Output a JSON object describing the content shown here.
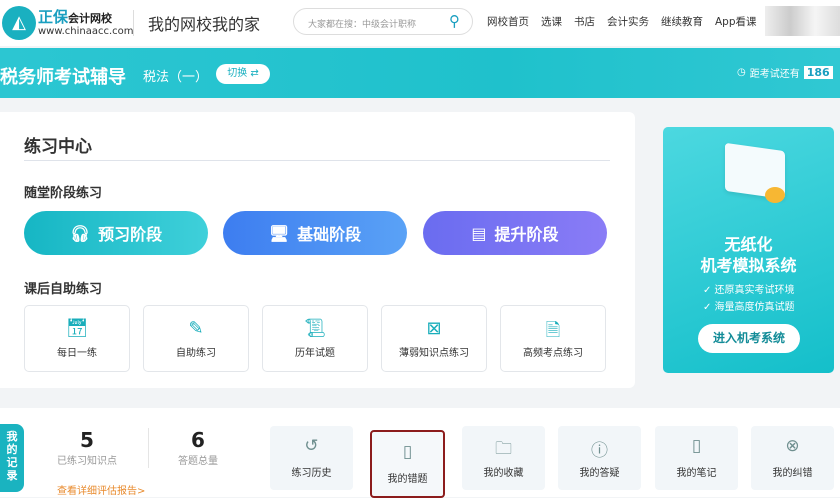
{
  "header": {
    "logo_text": "正保",
    "brand": "正保",
    "brand_sub": "会计网校",
    "url": "www.chinaacc.com",
    "slogan": "我的网校我的家",
    "search_placeholder": "大家都在搜：中级会计职称",
    "nav": [
      "网校首页",
      "选课",
      "书店",
      "会计实务",
      "继续教育",
      "App看课"
    ]
  },
  "banner": {
    "title": "税务师考试辅导",
    "subject": "税法（一）",
    "switch_label": "切换 ⇄",
    "countdown_label": "距考试还有",
    "days": "186"
  },
  "practice": {
    "title": "练习中心",
    "section1": "随堂阶段练习",
    "stages": [
      {
        "label": "预习阶段",
        "icon": "headphones-icon"
      },
      {
        "label": "基础阶段",
        "icon": "monitor-icon"
      },
      {
        "label": "提升阶段",
        "icon": "upload-book-icon"
      }
    ],
    "section2": "课后自助练习",
    "tiles": [
      {
        "label": "每日一练",
        "icon": "calendar-check-icon"
      },
      {
        "label": "自助练习",
        "icon": "pencil-icon"
      },
      {
        "label": "历年试题",
        "icon": "scroll-icon"
      },
      {
        "label": "薄弱知识点练习",
        "icon": "notebook-x-icon"
      },
      {
        "label": "高频考点练习",
        "icon": "document-clock-icon"
      }
    ]
  },
  "promo": {
    "title1": "无纸化",
    "title2": "机考模拟系统",
    "bullets": [
      "✓ 还原真实考试环境",
      "✓ 海量高度仿真试题"
    ],
    "button": "进入机考系统"
  },
  "records": {
    "tag": "我的记录",
    "stats": [
      {
        "value": "5",
        "label": "已练习知识点"
      },
      {
        "value": "6",
        "label": "答题总量"
      }
    ],
    "report_link": "查看详细评估报告>",
    "tiles": [
      {
        "label": "练习历史",
        "icon": "history-icon"
      },
      {
        "label": "我的错题",
        "icon": "wrong-questions-icon"
      },
      {
        "label": "我的收藏",
        "icon": "folder-icon"
      },
      {
        "label": "我的答疑",
        "icon": "question-icon"
      },
      {
        "label": "我的笔记",
        "icon": "notebook-icon"
      },
      {
        "label": "我的纠错",
        "icon": "search-x-icon"
      }
    ]
  }
}
